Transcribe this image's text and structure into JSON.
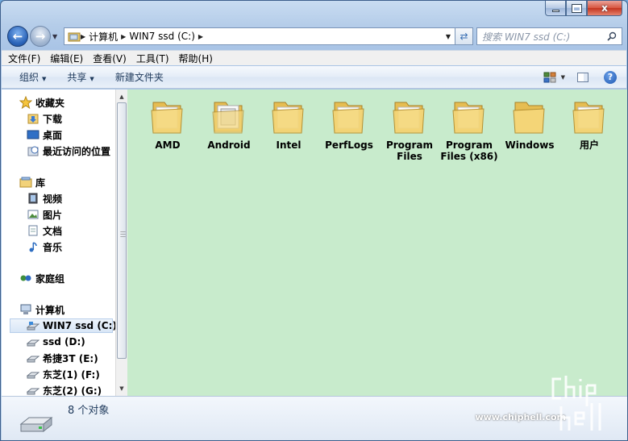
{
  "window": {
    "controls": {
      "minimize": "",
      "maximize": "",
      "close": "x"
    }
  },
  "address": {
    "segments": [
      "计算机",
      "WIN7 ssd (C:)"
    ],
    "search_placeholder": "搜索 WIN7 ssd (C:)"
  },
  "menu": [
    "文件(F)",
    "编辑(E)",
    "查看(V)",
    "工具(T)",
    "帮助(H)"
  ],
  "toolbar": {
    "organize": "组织",
    "share": "共享",
    "new_folder": "新建文件夹",
    "help": "?"
  },
  "nav": {
    "favorites": {
      "label": "收藏夹",
      "items": [
        "下载",
        "桌面",
        "最近访问的位置"
      ]
    },
    "libraries": {
      "label": "库",
      "items": [
        "视频",
        "图片",
        "文档",
        "音乐"
      ]
    },
    "homegroup": {
      "label": "家庭组"
    },
    "computer": {
      "label": "计算机",
      "items": [
        "WIN7 ssd (C:)",
        "ssd (D:)",
        "希捷3T (E:)",
        "东芝(1) (F:)",
        "东芝(2) (G:)"
      ]
    }
  },
  "files": [
    {
      "name": "AMD"
    },
    {
      "name": "Android"
    },
    {
      "name": "Intel"
    },
    {
      "name": "PerfLogs"
    },
    {
      "name": "Program Files"
    },
    {
      "name": "Program Files (x86)"
    },
    {
      "name": "Windows"
    },
    {
      "name": "用户"
    }
  ],
  "status": {
    "count": "8 个对象"
  },
  "watermark": {
    "url": "www.chiphell.com"
  },
  "colors": {
    "content_bg": "#c8ebcc",
    "accent": "#2a63b8"
  }
}
